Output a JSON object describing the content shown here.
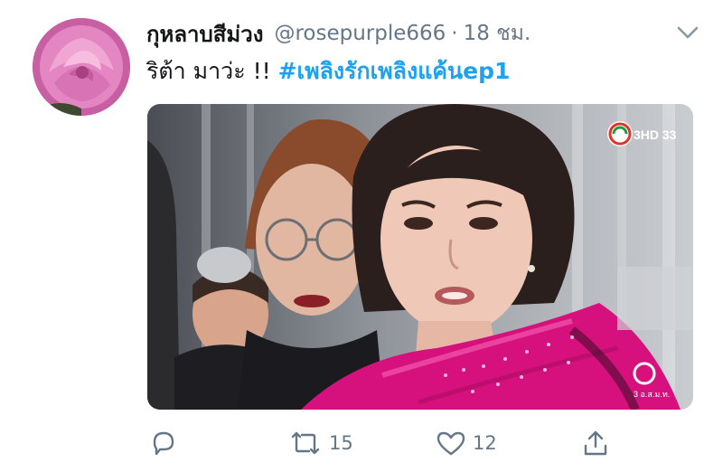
{
  "tweet": {
    "display_name": "กุหลาบสีม่วง",
    "handle": "@rosepurple666",
    "separator": "·",
    "timestamp": "18 ชม.",
    "text": "ริต้า มาว่ะ !!",
    "hashtag": "#เพลิงรักเพลิงแค้นep1"
  },
  "media": {
    "channel_logo": "3HD 33",
    "watermark": "3 อ.ส.ม.ท."
  },
  "actions": {
    "retweet_count": "15",
    "like_count": "12"
  },
  "icons": {
    "avatar": "pink-rose-avatar",
    "caret": "chevron-down-icon",
    "reply": "reply-icon",
    "retweet": "retweet-icon",
    "like": "heart-icon",
    "share": "share-icon"
  },
  "colors": {
    "link": "#1da1f2",
    "muted": "#657786",
    "text": "#14171a",
    "scarf": "#d6107d"
  }
}
